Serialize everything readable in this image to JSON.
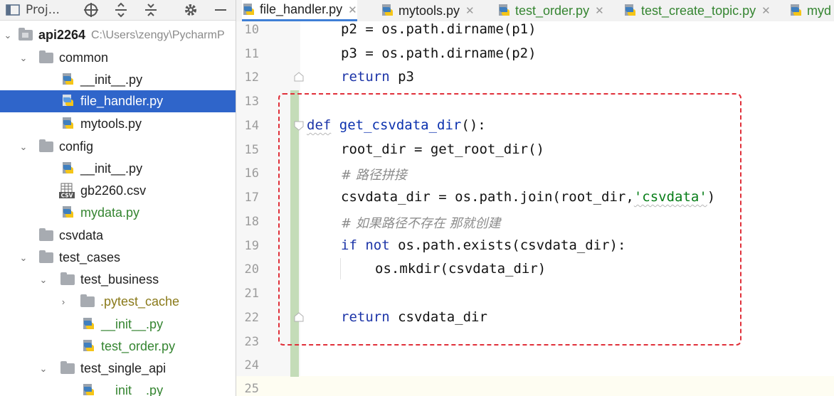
{
  "project_panel": {
    "title": "Proj...",
    "tree": [
      {
        "label": "api2264",
        "path_hint": "C:\\Users\\zengy\\PycharmP"
      },
      {
        "label": "common"
      },
      {
        "label": "__init__.py"
      },
      {
        "label": "file_handler.py"
      },
      {
        "label": "mytools.py"
      },
      {
        "label": "config"
      },
      {
        "label": "__init__.py"
      },
      {
        "label": "gb2260.csv"
      },
      {
        "label": "mydata.py"
      },
      {
        "label": "csvdata"
      },
      {
        "label": "test_cases"
      },
      {
        "label": "test_business"
      },
      {
        "label": ".pytest_cache"
      },
      {
        "label": "__init__.py"
      },
      {
        "label": "test_order.py"
      },
      {
        "label": "test_single_api"
      },
      {
        "label": "__init__.py"
      }
    ],
    "icons": {
      "selected_row_color": "#2f65ca",
      "new_file_color": "#358531"
    }
  },
  "tabs": [
    {
      "label": "file_handler.py",
      "active": true
    },
    {
      "label": "mytools.py"
    },
    {
      "label": "test_order.py"
    },
    {
      "label": "test_create_topic.py"
    },
    {
      "label": "myd"
    }
  ],
  "editor": {
    "line_numbers": [
      "10",
      "11",
      "12",
      "13",
      "14",
      "15",
      "16",
      "17",
      "18",
      "19",
      "20",
      "21",
      "22",
      "23",
      "24",
      "25"
    ],
    "code": {
      "l10": "p2 = os.path.dirname(p1)",
      "l11": "p3 = os.path.dirname(p2)",
      "l12_kw": "return",
      "l12_rest": " p3",
      "l14_kw": "def",
      "l14_fn": "get_csvdata_dir",
      "l14_rest": "():",
      "l15": "root_dir = get_root_dir()",
      "l16": "# 路径拼接",
      "l17_pre": "csvdata_dir = os.path.join(root_dir,",
      "l17_str": "'csvdata'",
      "l17_post": ")",
      "l18": "# 如果路径不存在 那就创建",
      "l19_kw1": "if",
      "l19_kw2": "not",
      "l19_rest": " os.path.exists(csvdata_dir):",
      "l20": "os.mkdir(csvdata_dir)",
      "l22_kw": "return",
      "l22_rest": " csvdata_dir"
    },
    "highlight_color": "#e0303a"
  }
}
